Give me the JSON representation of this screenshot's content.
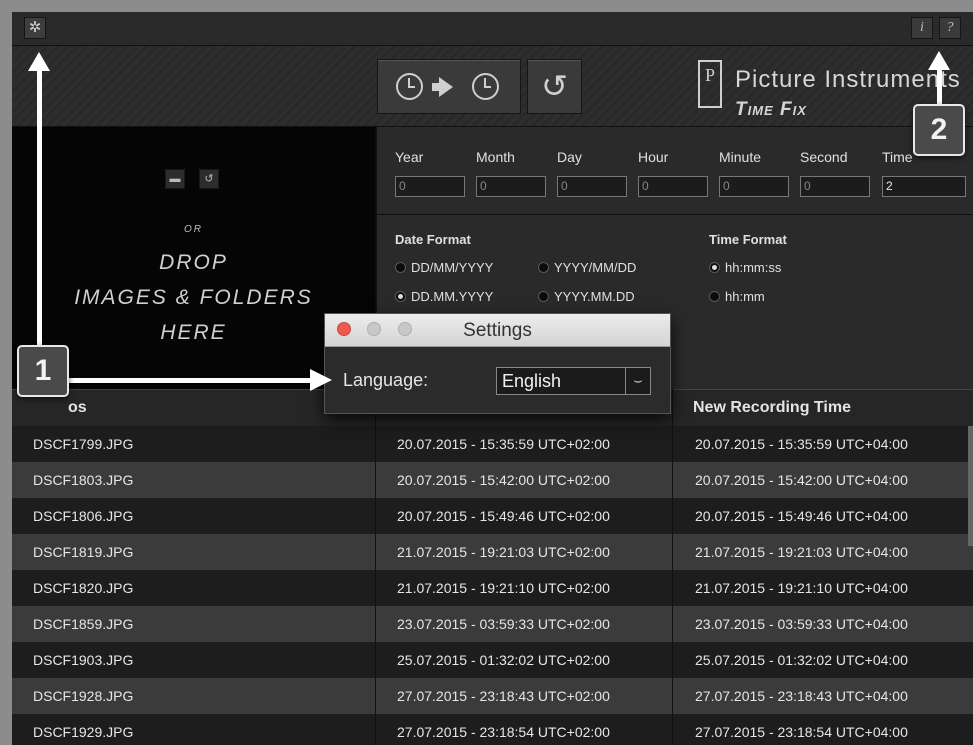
{
  "toolbar": {
    "settings_icon": "gear-icon",
    "info_label": "i",
    "help_label": "?"
  },
  "header": {
    "convert_button_icons": [
      "clock-icon",
      "arrow-right-icon",
      "clock-icon"
    ],
    "reset_button_icon": "rotate-ccw-icon",
    "brand_name": "Picture Instruments",
    "product_name": "Time Fix"
  },
  "dropzone": {
    "folder_icon": "folder-icon",
    "reset_icon": "rotate-ccw-icon",
    "or_text": "OR",
    "line1": "DROP",
    "line2": "IMAGES & FOLDERS",
    "line3": "HERE"
  },
  "offsets": {
    "fields": [
      {
        "label": "Year",
        "value": "0"
      },
      {
        "label": "Month",
        "value": "0"
      },
      {
        "label": "Day",
        "value": "0"
      },
      {
        "label": "Hour",
        "value": "0"
      },
      {
        "label": "Minute",
        "value": "0"
      },
      {
        "label": "Second",
        "value": "0"
      },
      {
        "label": "Time",
        "value": "2"
      }
    ]
  },
  "formats": {
    "date_title": "Date Format",
    "date_options": [
      {
        "label": "DD/MM/YYYY",
        "selected": false
      },
      {
        "label": "YYYY/MM/DD",
        "selected": false
      },
      {
        "label": "DD.MM.YYYY",
        "selected": true
      },
      {
        "label": "YYYY.MM.DD",
        "selected": false
      }
    ],
    "time_title": "Time Format",
    "time_options": [
      {
        "label": "hh:mm:ss",
        "selected": true
      },
      {
        "label": "hh:mm",
        "selected": false
      }
    ]
  },
  "table": {
    "headers": [
      "os",
      "",
      "New Recording Time"
    ],
    "rows": [
      {
        "file": "DSCF1799.JPG",
        "original": "20.07.2015 - 15:35:59  UTC+02:00",
        "new": "20.07.2015 - 15:35:59  UTC+04:00"
      },
      {
        "file": "DSCF1803.JPG",
        "original": "20.07.2015 - 15:42:00  UTC+02:00",
        "new": "20.07.2015 - 15:42:00  UTC+04:00"
      },
      {
        "file": "DSCF1806.JPG",
        "original": "20.07.2015 - 15:49:46  UTC+02:00",
        "new": "20.07.2015 - 15:49:46  UTC+04:00"
      },
      {
        "file": "DSCF1819.JPG",
        "original": "21.07.2015 - 19:21:03  UTC+02:00",
        "new": "21.07.2015 - 19:21:03  UTC+04:00"
      },
      {
        "file": "DSCF1820.JPG",
        "original": "21.07.2015 - 19:21:10  UTC+02:00",
        "new": "21.07.2015 - 19:21:10  UTC+04:00"
      },
      {
        "file": "DSCF1859.JPG",
        "original": "23.07.2015 - 03:59:33  UTC+02:00",
        "new": "23.07.2015 - 03:59:33  UTC+04:00"
      },
      {
        "file": "DSCF1903.JPG",
        "original": "25.07.2015 - 01:32:02  UTC+02:00",
        "new": "25.07.2015 - 01:32:02  UTC+04:00"
      },
      {
        "file": "DSCF1928.JPG",
        "original": "27.07.2015 - 23:18:43  UTC+02:00",
        "new": "27.07.2015 - 23:18:43  UTC+04:00"
      },
      {
        "file": "DSCF1929.JPG",
        "original": "27.07.2015 - 23:18:54  UTC+02:00",
        "new": "27.07.2015 - 23:18:54  UTC+04:00"
      }
    ]
  },
  "settings_dialog": {
    "title": "Settings",
    "language_label": "Language:",
    "language_value": "English",
    "traffic_colors": [
      "#ee5a52",
      "#c8c8c8",
      "#c8c8c8"
    ]
  },
  "annotations": {
    "badge1": "1",
    "badge2": "2"
  }
}
